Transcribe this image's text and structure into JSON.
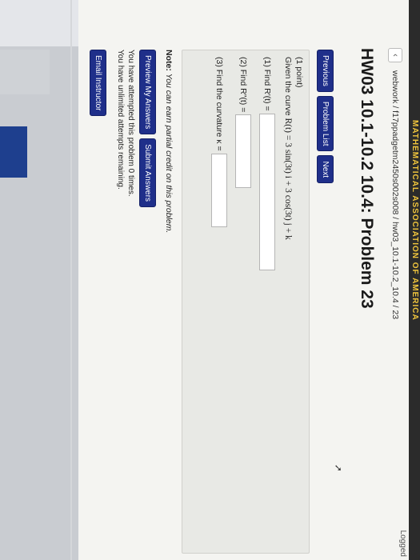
{
  "header": {
    "banner_text": "MATHEMATICAL ASSOCIATION OF AMERICA",
    "logged_text": "Logged"
  },
  "breadcrumb": "webwork / f17ppadgetm2450s002s008 / hw03_10.1-10.2_10.4 / 23",
  "title": "HW03 10.1-10.2 10.4: Problem 23",
  "nav": {
    "previous": "Previous",
    "problem_list": "Problem List",
    "next": "Next"
  },
  "problem": {
    "points": "(1 point)",
    "given_prefix": "Given the curve",
    "curve": "R(t) = 3 sin(3t) i + 3 cos(3t) j + k",
    "q1_label": "(1) Find R′(t) =",
    "q2_label": "(2) Find R″(t) =",
    "q3_label": "(3) Find the curvature κ =",
    "q1_value": "",
    "q2_value": "",
    "q3_value": ""
  },
  "note": {
    "label": "Note:",
    "text": "You can earn partial credit on this problem."
  },
  "actions": {
    "preview": "Preview My Answers",
    "submit": "Submit Answers"
  },
  "status": {
    "attempted": "You have attempted this problem 0 times.",
    "remaining": "You have unlimited attempts remaining."
  },
  "email_label": "Email Instructor",
  "colors": {
    "button_bg": "#1f2f8a",
    "banner_text": "#f0c53c",
    "side_blue": "#1e3f8e"
  }
}
